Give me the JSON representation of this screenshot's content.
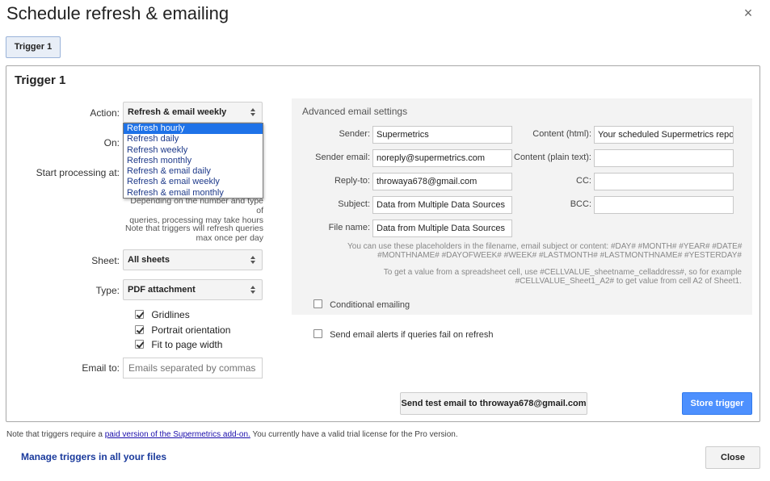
{
  "dialog": {
    "title": "Schedule refresh & emailing",
    "close_symbol": "×"
  },
  "tabs": [
    {
      "label": "Trigger 1",
      "active": true
    }
  ],
  "panel": {
    "title": "Trigger 1"
  },
  "left": {
    "action_label": "Action:",
    "action_value": "Refresh & email weekly",
    "action_options": [
      "Refresh hourly",
      "Refresh daily",
      "Refresh weekly",
      "Refresh monthly",
      "Refresh & email daily",
      "Refresh & email weekly",
      "Refresh & email monthly"
    ],
    "action_highlighted_option": "Refresh hourly",
    "on_label": "On:",
    "start_label": "Start processing at:",
    "hint1_line1": "Depending on the number and type of",
    "hint1_line2": "queries, processing may take hours",
    "hint2_line1": "Note that triggers will refresh queries",
    "hint2_line2": "max once per day",
    "sheet_label": "Sheet:",
    "sheet_value": "All sheets",
    "type_label": "Type:",
    "type_value": "PDF attachment",
    "checkboxes": [
      {
        "label": "Gridlines",
        "checked": true
      },
      {
        "label": "Portrait orientation",
        "checked": true
      },
      {
        "label": "Fit to page width",
        "checked": true
      }
    ],
    "email_label": "Email to:",
    "email_placeholder": "Emails separated by commas"
  },
  "advanced": {
    "title": "Advanced email settings",
    "sender_label": "Sender:",
    "sender_value": "Supermetrics",
    "sender_email_label": "Sender email:",
    "sender_email_value": "noreply@supermetrics.com",
    "reply_to_label": "Reply-to:",
    "reply_to_value": "throwaya678@gmail.com",
    "subject_label": "Subject:",
    "subject_value": "Data from Multiple Data Sources",
    "file_name_label": "File name:",
    "file_name_value": "Data from Multiple Data Sources",
    "content_html_label": "Content (html):",
    "content_html_value": "Your scheduled Supermetrics report",
    "content_plain_label": "Content (plain text):",
    "content_plain_value": "",
    "cc_label": "CC:",
    "cc_value": "",
    "bcc_label": "BCC:",
    "bcc_value": "",
    "placeholders_line1": "You can use these placeholders in the filename, email subject or content: #DAY# #MONTH# #YEAR# #DATE#",
    "placeholders_line2": "#MONTHNAME# #DAYOFWEEK# #WEEK# #LASTMONTH# #LASTMONTHNAME# #YESTERDAY#",
    "cellvalue_line1": "To get a value from a spreadsheet cell, use #CELLVALUE_sheetname_celladdress#, so for example",
    "cellvalue_line2": "#CELLVALUE_Sheet1_A2# to get value from cell A2 of Sheet1.",
    "conditional_label": "Conditional emailing",
    "conditional_checked": false
  },
  "alerts": {
    "label": "Send email alerts if queries fail on refresh",
    "checked": false
  },
  "buttons": {
    "test_email": "Send test email to throwaya678@gmail.com",
    "store_trigger": "Store trigger",
    "close": "Close"
  },
  "footer": {
    "note_prefix": "Note that triggers require a ",
    "note_link": "paid version of the Supermetrics add-on.",
    "note_suffix": " You currently have a valid trial license for the Pro version.",
    "manage_link": "Manage triggers in all your files"
  },
  "colors": {
    "accent_blue": "#4d90fe",
    "selection_blue": "#1e72e8",
    "link_blue": "#1a0dab"
  }
}
